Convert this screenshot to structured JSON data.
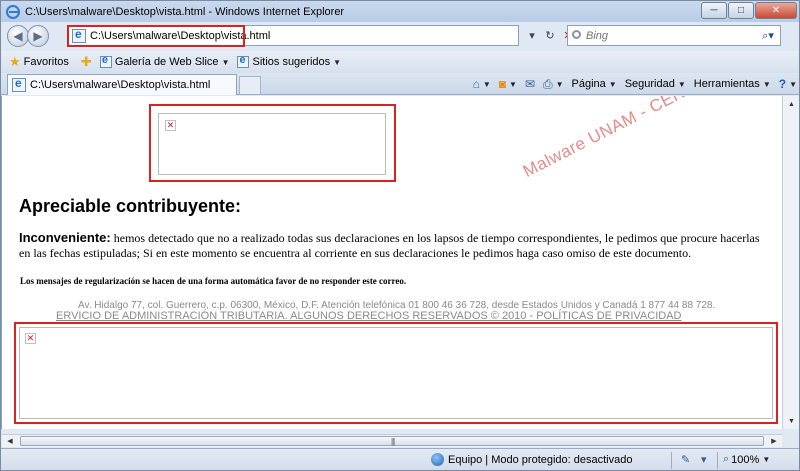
{
  "window": {
    "title": "C:\\Users\\malware\\Desktop\\vista.html - Windows Internet Explorer",
    "minimize_glyph": "─",
    "maximize_glyph": "□",
    "close_glyph": "✕"
  },
  "address_bar": {
    "url": "C:\\Users\\malware\\Desktop\\vista.html",
    "refresh_glyph": "↻",
    "stop_glyph": "✕",
    "dropdown_glyph": "▾"
  },
  "search": {
    "placeholder": "Bing",
    "go_glyph": "⌕▾"
  },
  "favorites_bar": {
    "favorites_label": "Favoritos",
    "items": [
      {
        "label": "Galería de Web Slice"
      },
      {
        "label": "Sitios sugeridos"
      }
    ]
  },
  "tabs": [
    {
      "label": "C:\\Users\\malware\\Desktop\\vista.html"
    }
  ],
  "command_bar": {
    "page_label": "Página",
    "security_label": "Seguridad",
    "tools_label": "Herramientas"
  },
  "page": {
    "watermark": "Malware UNAM - CERT",
    "heading": "Apreciable contribuyente:",
    "paragraph_lead": "Inconveniente:",
    "paragraph_body": " hemos detectado que no a realizado todas sus declaraciones en los lapsos de tiempo correspondientes, le pedimos que procure hacerlas en las fechas estipuladas; Si en este momento se encuentra al corriente en sus declaraciones le pedimos haga caso omiso de este documento.",
    "note": "Los mensajes de regularización se hacen de una forma automática favor de no responder este correo.",
    "address_line": "Av. Hidalgo 77, col. Guerrero, c.p. 06300, México, D.F. Atención telefónica 01 800 46 36 728, desde Estados Unidos y Canadá 1 877 44 88 728.",
    "footer_line": "ERVICIO DE ADMINISTRACIÓN TRIBUTARIA. ALGUNOS DERECHOS RESERVADOS © 2010 - POLÍTICAS DE PRIVACIDAD",
    "broken_image_glyph": "✕"
  },
  "status_bar": {
    "zone_text": "Equipo | Modo protegido: desactivado",
    "zoom": "100%"
  },
  "colors": {
    "highlight_red": "#d9231f",
    "watermark": "#e48c88"
  }
}
